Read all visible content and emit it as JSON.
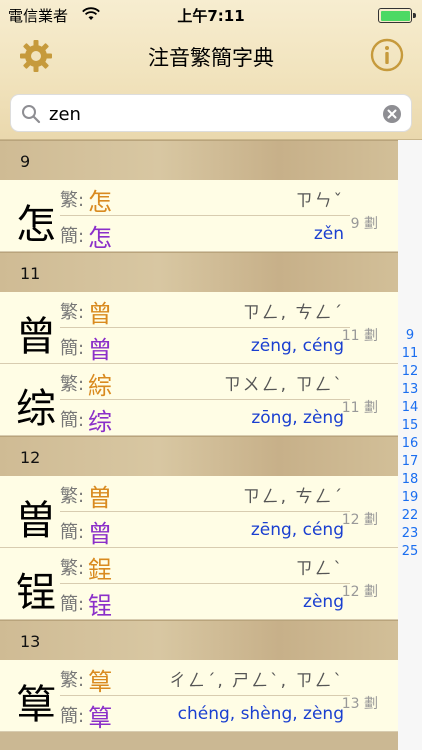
{
  "status_bar": {
    "carrier": "電信業者",
    "time": "上午7:11"
  },
  "nav": {
    "title": "注音繁簡字典"
  },
  "search": {
    "value": "zen"
  },
  "labels": {
    "traditional": "繁:",
    "simplified": "簡:"
  },
  "sections": [
    {
      "header": "9",
      "entries": [
        {
          "char": "怎",
          "trad": "怎",
          "simp": "怎",
          "bopomofo": "ㄗㄣˇ",
          "pinyin": "zěn",
          "strokes": "9 劃"
        }
      ]
    },
    {
      "header": "11",
      "entries": [
        {
          "char": "曾",
          "trad": "曾",
          "simp": "曾",
          "bopomofo": "ㄗㄥ, ㄘㄥˊ",
          "pinyin": "zēng, céng",
          "strokes": "11 劃"
        },
        {
          "char": "综",
          "trad": "綜",
          "simp": "综",
          "bopomofo": "ㄗㄨㄥ, ㄗㄥˋ",
          "pinyin": "zōng, zèng",
          "strokes": "11 劃"
        }
      ]
    },
    {
      "header": "12",
      "entries": [
        {
          "char": "曽",
          "trad": "曽",
          "simp": "曾",
          "bopomofo": "ㄗㄥ, ㄘㄥˊ",
          "pinyin": "zēng, céng",
          "strokes": "12 劃"
        },
        {
          "char": "锃",
          "trad": "鋥",
          "simp": "锃",
          "bopomofo": "ㄗㄥˋ",
          "pinyin": "zèng",
          "strokes": "12 劃"
        }
      ]
    },
    {
      "header": "13",
      "entries": [
        {
          "char": "筸",
          "trad": "筸",
          "simp": "筸",
          "bopomofo": "ㄔㄥˊ, ㄕㄥˋ, ㄗㄥˋ",
          "pinyin": "chéng, shèng, zèng",
          "strokes": "13 劃"
        }
      ]
    }
  ],
  "index": [
    "9",
    "11",
    "12",
    "13",
    "14",
    "15",
    "16",
    "17",
    "18",
    "19",
    "22",
    "23",
    "25"
  ],
  "colors": {
    "traditional": "#d98a1f",
    "simplified": "#8b2fc9",
    "pinyin": "#1a3fd0",
    "index": "#1a6ef0",
    "battery": "#4cd964"
  }
}
